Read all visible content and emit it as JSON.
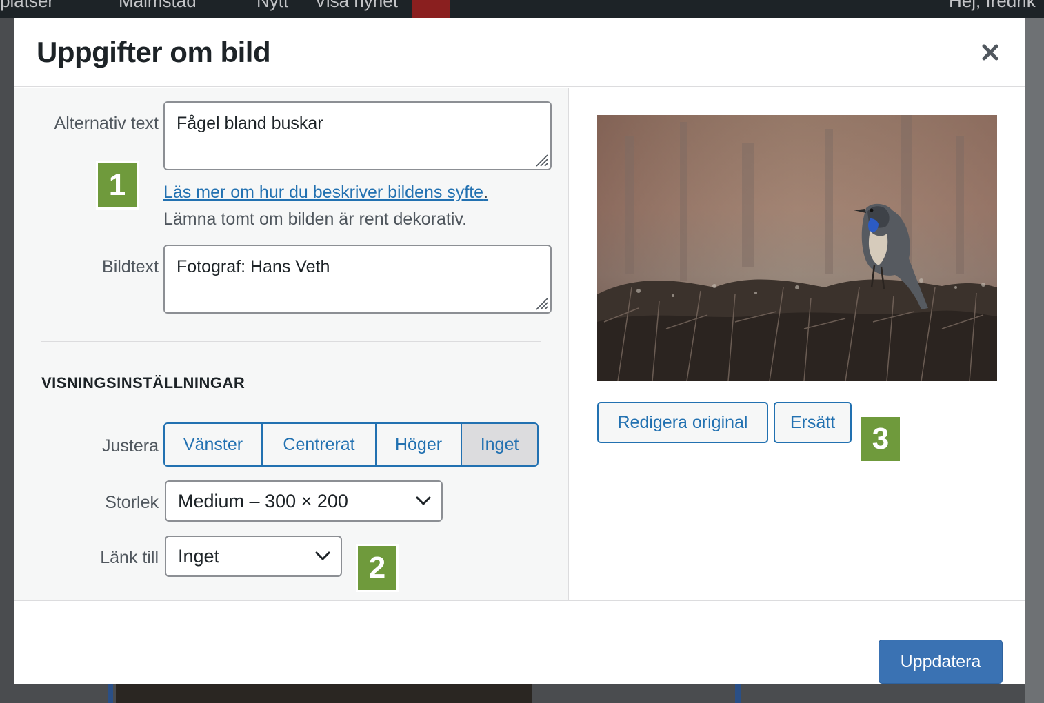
{
  "background": {
    "admin_bar": [
      "platser",
      "Malmstad",
      "Nytt",
      "Visa nyhet",
      "Hej, fredrik"
    ]
  },
  "modal": {
    "title": "Uppgifter om bild",
    "close_icon": "close-icon"
  },
  "fields": {
    "alt_label": "Alternativ text",
    "alt_value": "Fågel bland buskar",
    "alt_link": "Läs mer om hur du beskriver bildens syfte",
    "alt_link_suffix": ".",
    "alt_hint": "Lämna tomt om bilden är rent dekorativ.",
    "caption_label": "Bildtext",
    "caption_value": "Fotograf: Hans Veth"
  },
  "display": {
    "section_title": "VISNINGSINSTÄLLNINGAR",
    "align_label": "Justera",
    "align_options": [
      "Vänster",
      "Centrerat",
      "Höger",
      "Inget"
    ],
    "align_selected": "Inget",
    "size_label": "Storlek",
    "size_value": "Medium – 300 × 200",
    "link_label": "Länk till",
    "link_value": "Inget"
  },
  "image_panel": {
    "edit_original": "Redigera original",
    "replace": "Ersätt"
  },
  "footer": {
    "update_button": "Uppdatera"
  },
  "badges": [
    "1",
    "2",
    "3"
  ],
  "colors": {
    "accent": "#2271b1",
    "primary_button": "#3a72b3",
    "badge_green": "#6f9a3c",
    "text_dark": "#1d2327"
  }
}
